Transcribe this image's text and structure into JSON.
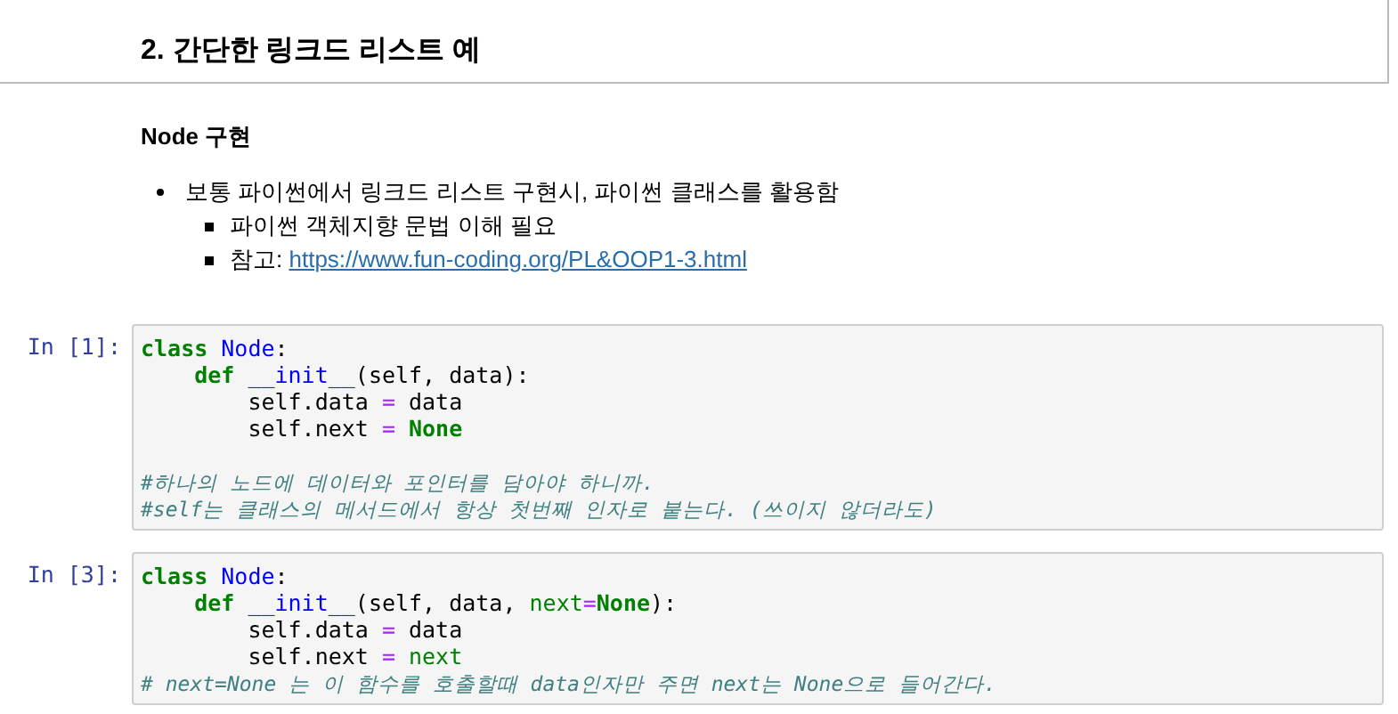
{
  "heading": "2. 간단한 링크드 리스트 예",
  "subheading": "Node 구현",
  "bullets": [
    {
      "text": "보통 파이썬에서 링크드 리스트 구현시, 파이썬 클래스를 활용함",
      "children": [
        {
          "text": "파이썬 객체지향 문법 이해 필요"
        },
        {
          "text": "참고: ",
          "link": "https://www.fun-coding.org/PL&OOP1-3.html"
        }
      ]
    }
  ],
  "cells": [
    {
      "prompt": "In [1]:",
      "lines": [
        {
          "kind": "code",
          "tokens": [
            {
              "kind": "keyword",
              "text": "class "
            },
            {
              "kind": "name",
              "text": "Node"
            },
            {
              "kind": "plain",
              "text": ":"
            }
          ],
          "children": [
            {
              "kind": "code",
              "tokens": [
                {
                  "kind": "keyword",
                  "text": "def "
                },
                {
                  "kind": "name",
                  "text": "__init__"
                },
                {
                  "kind": "plain",
                  "text": "(self, data):"
                }
              ],
              "children": [
                {
                  "kind": "code",
                  "tokens": [
                    {
                      "kind": "plain",
                      "text": "self.data "
                    },
                    {
                      "kind": "operator",
                      "text": "="
                    },
                    {
                      "kind": "plain",
                      "text": " data"
                    }
                  ]
                },
                {
                  "kind": "code",
                  "tokens": [
                    {
                      "kind": "plain",
                      "text": "self.next "
                    },
                    {
                      "kind": "operator",
                      "text": "="
                    },
                    {
                      "kind": "keyword",
                      "text": " None"
                    }
                  ]
                }
              ]
            }
          ]
        },
        {
          "kind": "blank"
        },
        {
          "kind": "code",
          "tokens": [
            {
              "kind": "comment",
              "text": "#하나의 노드에 데이터와 포인터를 담아야 하니까."
            }
          ]
        },
        {
          "kind": "code",
          "tokens": [
            {
              "kind": "comment",
              "text": "#self는 클래스의 메서드에서 항상 첫번째 인자로 붙는다. (쓰이지 않더라도)"
            }
          ]
        }
      ]
    },
    {
      "prompt": "In [3]:",
      "lines": [
        {
          "kind": "code",
          "tokens": [
            {
              "kind": "keyword",
              "text": "class "
            },
            {
              "kind": "name",
              "text": "Node"
            },
            {
              "kind": "plain",
              "text": ":"
            }
          ],
          "children": [
            {
              "kind": "code",
              "tokens": [
                {
                  "kind": "keyword",
                  "text": "def "
                },
                {
                  "kind": "name",
                  "text": "__init__"
                },
                {
                  "kind": "plain",
                  "text": "(self, data, "
                },
                {
                  "kind": "param",
                  "text": "next"
                },
                {
                  "kind": "operator",
                  "text": "="
                },
                {
                  "kind": "keyword",
                  "text": "None"
                },
                {
                  "kind": "plain",
                  "text": "):"
                }
              ],
              "children": [
                {
                  "kind": "code",
                  "tokens": [
                    {
                      "kind": "plain",
                      "text": "self.data "
                    },
                    {
                      "kind": "operator",
                      "text": "="
                    },
                    {
                      "kind": "plain",
                      "text": " data"
                    }
                  ]
                },
                {
                  "kind": "code",
                  "tokens": [
                    {
                      "kind": "plain",
                      "text": "self.next "
                    },
                    {
                      "kind": "operator",
                      "text": "="
                    },
                    {
                      "kind": "param",
                      "text": " next"
                    }
                  ]
                }
              ]
            }
          ]
        },
        {
          "kind": "code",
          "tokens": [
            {
              "kind": "comment",
              "text": "# next=None 는 이 함수를 호출할때 data인자만 주면 next는 None으로 들어간다."
            }
          ]
        }
      ]
    }
  ]
}
